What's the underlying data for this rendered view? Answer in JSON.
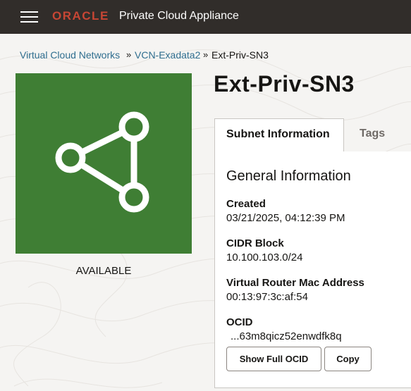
{
  "header": {
    "brand": "ORACLE",
    "product": "Private Cloud Appliance",
    "menu_icon": "hamburger-menu-icon"
  },
  "breadcrumb": {
    "items": [
      {
        "label": "Virtual Cloud Networks"
      },
      {
        "label": "VCN-Exadata2"
      },
      {
        "label": "Ext-Priv-SN3"
      }
    ],
    "separator": "»"
  },
  "resource": {
    "icon": "share-network-icon",
    "status": "AVAILABLE",
    "tile_color": "#3f7e34"
  },
  "page_title": "Ext-Priv-SN3",
  "tabs": [
    {
      "label": "Subnet Information",
      "active": true
    },
    {
      "label": "Tags",
      "active": false
    }
  ],
  "general": {
    "title": "General Information",
    "created_label": "Created",
    "created_value": "03/21/2025, 04:12:39 PM",
    "cidr_label": "CIDR Block",
    "cidr_value": "10.100.103.0/24",
    "mac_label": "Virtual Router Mac Address",
    "mac_value": "00:13:97:3c:af:54",
    "ocid_label": "OCID",
    "ocid_value": "...63m8qicz52enwdfk8q",
    "show_full_label": "Show Full OCID",
    "copy_label": "Copy"
  }
}
